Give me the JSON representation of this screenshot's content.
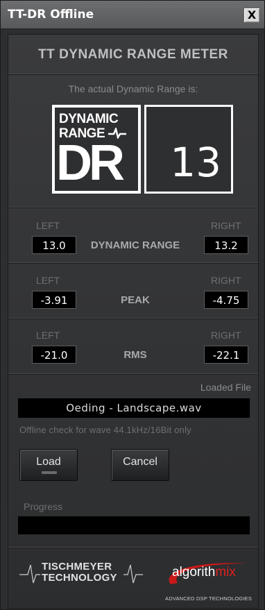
{
  "window": {
    "title": "TT-DR Offline",
    "close_label": "X"
  },
  "app_title": "TT DYNAMIC RANGE METER",
  "subtitle": "The actual Dynamic Range is:",
  "logo": {
    "line1": "DYNAMIC",
    "line2": "RANGE",
    "big": "DR"
  },
  "dr_value": "13",
  "rows": [
    {
      "left_label": "LEFT",
      "right_label": "RIGHT",
      "name": "DYNAMIC RANGE",
      "left": "13.0",
      "right": "13.2"
    },
    {
      "left_label": "LEFT",
      "right_label": "RIGHT",
      "name": "PEAK",
      "left": "-3.91",
      "right": "-4.75"
    },
    {
      "left_label": "LEFT",
      "right_label": "RIGHT",
      "name": "RMS",
      "left": "-21.0",
      "right": "-22.1"
    }
  ],
  "loaded_file_label": "Loaded File",
  "loaded_file": "Oeding - Landscape.wav",
  "offline_note": "Offline check for wave 44.1kHz/16Bit only",
  "buttons": {
    "load": "Load",
    "cancel": "Cancel"
  },
  "progress": {
    "label": "Progress",
    "value": 0
  },
  "footer": {
    "tischmeyer_line1": "TISCHMEYER",
    "tischmeyer_line2": "TECHNOLOGY",
    "algo_part1": "algorith",
    "algo_part2": "mix",
    "algo_sub": "ADVANCED DSP TECHNOLOGIES"
  },
  "colors": {
    "accent_red": "#e02020",
    "background": "#2d2e30"
  }
}
